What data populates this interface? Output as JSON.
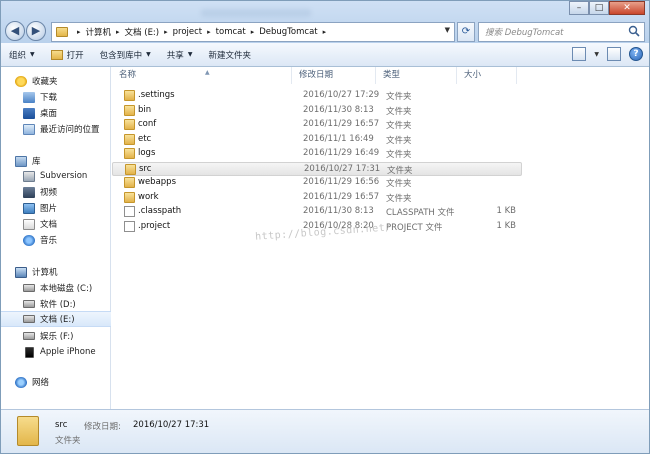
{
  "address": {
    "crumbs": [
      "计算机",
      "文档 (E:)",
      "project",
      "tomcat",
      "DebugTomcat"
    ]
  },
  "search": {
    "placeholder": "搜索 DebugTomcat"
  },
  "toolbar": {
    "organize": "组织",
    "open": "打开",
    "include_in_library": "包含到库中",
    "share": "共享",
    "new_folder": "新建文件夹"
  },
  "navigation": {
    "favorites": "收藏夹",
    "downloads": "下载",
    "desktop": "桌面",
    "recent": "最近访问的位置",
    "libraries": "库",
    "subversion": "Subversion",
    "videos": "视频",
    "pictures": "图片",
    "documents": "文档",
    "music": "音乐",
    "computer": "计算机",
    "drive_c": "本地磁盘 (C:)",
    "drive_d": "软件 (D:)",
    "drive_e": "文档 (E:)",
    "drive_f": "娱乐 (F:)",
    "iphone": "Apple iPhone",
    "network": "网络"
  },
  "columns": {
    "name": "名称",
    "date": "修改日期",
    "type": "类型",
    "size": "大小"
  },
  "files": [
    {
      "name": ".settings",
      "date": "2016/10/27 17:29",
      "type": "文件夹",
      "size": "",
      "icon": "folder"
    },
    {
      "name": "bin",
      "date": "2016/11/30 8:13",
      "type": "文件夹",
      "size": "",
      "icon": "folder"
    },
    {
      "name": "conf",
      "date": "2016/11/29 16:57",
      "type": "文件夹",
      "size": "",
      "icon": "folder"
    },
    {
      "name": "etc",
      "date": "2016/11/1 16:49",
      "type": "文件夹",
      "size": "",
      "icon": "folder"
    },
    {
      "name": "logs",
      "date": "2016/11/29 16:49",
      "type": "文件夹",
      "size": "",
      "icon": "folder"
    },
    {
      "name": "src",
      "date": "2016/10/27 17:31",
      "type": "文件夹",
      "size": "",
      "icon": "folder",
      "selected": true
    },
    {
      "name": "webapps",
      "date": "2016/11/29 16:56",
      "type": "文件夹",
      "size": "",
      "icon": "folder"
    },
    {
      "name": "work",
      "date": "2016/11/29 16:57",
      "type": "文件夹",
      "size": "",
      "icon": "folder"
    },
    {
      "name": ".classpath",
      "date": "2016/11/30 8:13",
      "type": "CLASSPATH 文件",
      "size": "1 KB",
      "icon": "file"
    },
    {
      "name": ".project",
      "date": "2016/10/28 8:20",
      "type": "PROJECT 文件",
      "size": "1 KB",
      "icon": "file"
    }
  ],
  "watermark": "http://blog.csdn.net/",
  "details": {
    "name": "src",
    "modified_label": "修改日期:",
    "modified_value": "2016/10/27 17:31",
    "type": "文件夹"
  }
}
